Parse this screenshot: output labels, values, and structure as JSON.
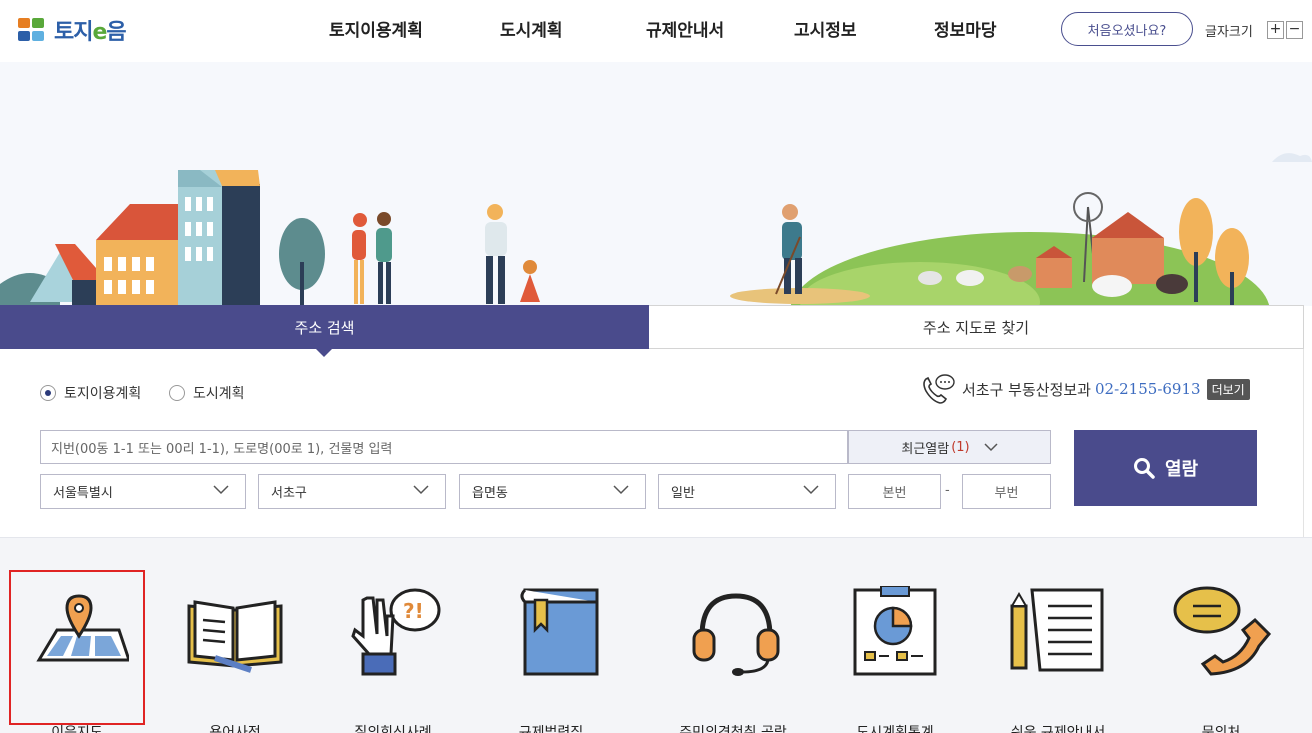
{
  "header": {
    "logo_text": "토지",
    "logo_e": "e",
    "logo_text2": "음",
    "nav": [
      "토지이용계획",
      "도시계획",
      "규제안내서",
      "고시정보",
      "정보마당"
    ],
    "first_visit_button": "처음오셨나요?",
    "font_size_label": "글자크기",
    "font_size_plus": "+",
    "font_size_minus": "−"
  },
  "tabs": {
    "address_search": "주소 검색",
    "map_search": "주소 지도로 찾기"
  },
  "search": {
    "radio_options": [
      "토지이용계획",
      "도시계획"
    ],
    "selected_radio": "토지이용계획",
    "phone_label": "서초구 부동산정보과",
    "phone_number": "02-2155-6913",
    "more_button": "더보기",
    "address_placeholder": "지번(00동 1-1 또는 00리 1-1), 도로명(00로 1), 건물명 입력",
    "recent_label": "최근열람",
    "recent_count": "(1)",
    "selects": [
      "서울특별시",
      "서초구",
      "읍면동",
      "일반"
    ],
    "main_number_placeholder": "본번",
    "sub_number_placeholder": "부번",
    "dash": "-",
    "search_button": "열람"
  },
  "quick_menu": {
    "items": [
      "이음지도",
      "용어사전",
      "질의회신사례",
      "규제법령집",
      "주민의견청취 공람",
      "도시계획통계",
      "쉬운 규제안내서",
      "문의처"
    ],
    "selected": "이음지도"
  },
  "colors": {
    "primary": "#4a4b8c",
    "accent_blue": "#3d6cc0",
    "highlight_red": "#e02424"
  }
}
